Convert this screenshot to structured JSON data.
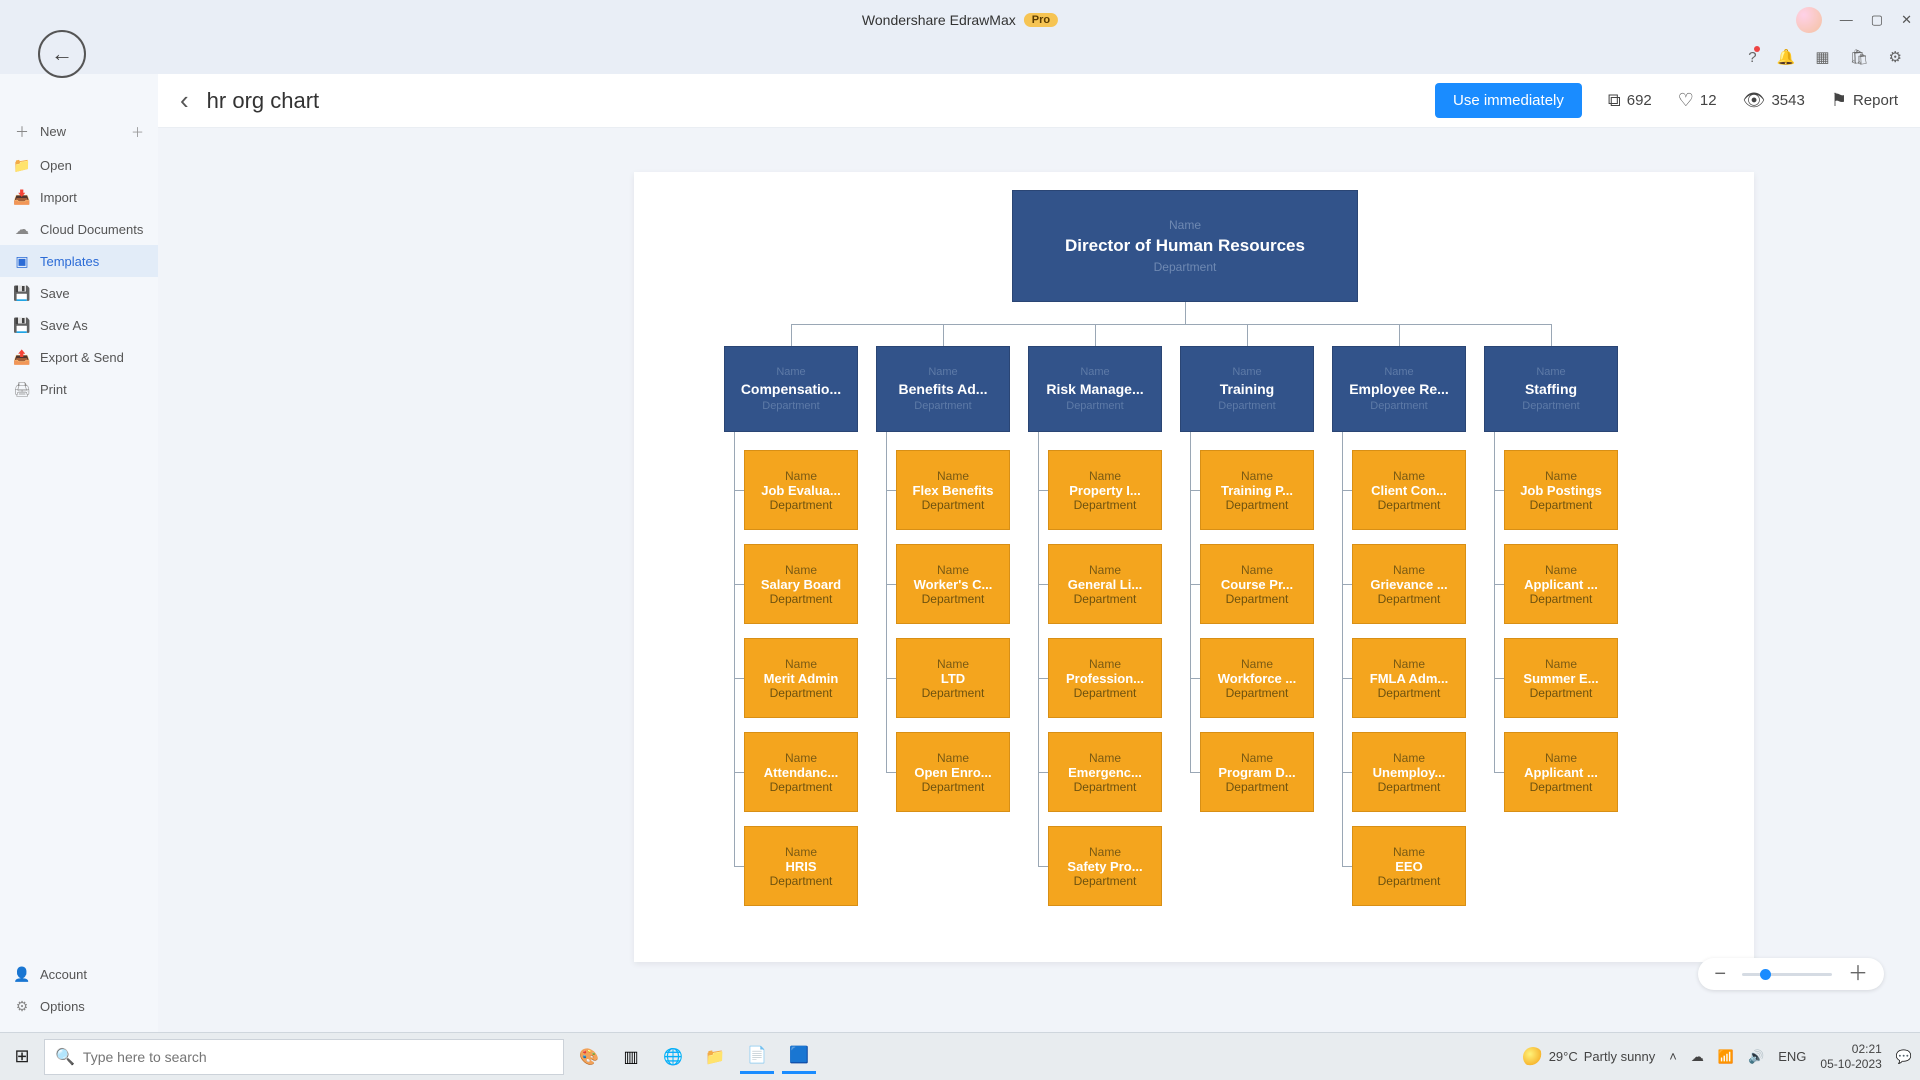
{
  "app": {
    "title": "Wondershare EdrawMax",
    "badge": "Pro"
  },
  "toolbar_icons": {
    "help": "?",
    "bell": "🔔",
    "grid": "▦",
    "store": "🛍",
    "gear": "⚙"
  },
  "sidebar": {
    "items": [
      {
        "icon": "＋",
        "label": "New",
        "plus": "＋"
      },
      {
        "icon": "📁",
        "label": "Open"
      },
      {
        "icon": "📥",
        "label": "Import"
      },
      {
        "icon": "☁",
        "label": "Cloud Documents"
      },
      {
        "icon": "▣",
        "label": "Templates",
        "active": true
      },
      {
        "icon": "💾",
        "label": "Save"
      },
      {
        "icon": "💾",
        "label": "Save As"
      },
      {
        "icon": "📤",
        "label": "Export & Send"
      },
      {
        "icon": "🖨",
        "label": "Print"
      }
    ],
    "bottom": [
      {
        "icon": "👤",
        "label": "Account"
      },
      {
        "icon": "⚙",
        "label": "Options"
      }
    ]
  },
  "header": {
    "title": "hr org chart",
    "use_btn": "Use immediately",
    "stats": {
      "copies": "692",
      "likes": "12",
      "views": "3543",
      "report": "Report"
    }
  },
  "org": {
    "root": {
      "top": "Name",
      "title": "Director of Human Resources",
      "bottom": "Department"
    },
    "columns": [
      {
        "head": "Compensatio...",
        "items": [
          "Job Evalua...",
          "Salary Board",
          "Merit Admin",
          "Attendanc...",
          "HRIS"
        ]
      },
      {
        "head": "Benefits Ad...",
        "items": [
          "Flex Benefits",
          "Worker's C...",
          "LTD",
          "Open Enro..."
        ]
      },
      {
        "head": "Risk Manage...",
        "items": [
          "Property I...",
          "General Li...",
          "Profession...",
          "Emergenc...",
          "Safety Pro..."
        ]
      },
      {
        "head": "Training",
        "items": [
          "Training P...",
          "Course Pr...",
          "Workforce ...",
          "Program D..."
        ]
      },
      {
        "head": "Employee Re...",
        "items": [
          "Client Con...",
          "Grievance ...",
          "FMLA Adm...",
          "Unemploy...",
          "EEO"
        ]
      },
      {
        "head": "Staffing",
        "items": [
          "Job Postings",
          "Applicant ...",
          "Summer E...",
          "Applicant ..."
        ]
      }
    ],
    "name_label": "Name",
    "dept_label": "Department",
    "head_top": "Name",
    "head_bottom": "Department"
  },
  "taskbar": {
    "search_placeholder": "Type here to search",
    "weather": {
      "temp": "29°C",
      "desc": "Partly sunny"
    },
    "time": "02:21",
    "date": "05-10-2023"
  }
}
